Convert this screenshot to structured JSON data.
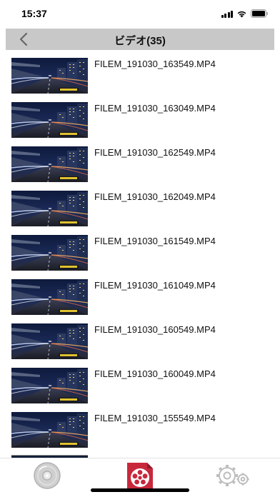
{
  "status_bar": {
    "time": "15:37",
    "icons": [
      "cellular-signal-icon",
      "wifi-icon",
      "battery-icon"
    ]
  },
  "header": {
    "title": "ビデオ(35)",
    "back_icon": "chevron-left-icon"
  },
  "videos": [
    {
      "file_name": "FILEM_191030_163549.MP4"
    },
    {
      "file_name": "FILEM_191030_163049.MP4"
    },
    {
      "file_name": "FILEM_191030_162549.MP4"
    },
    {
      "file_name": "FILEM_191030_162049.MP4"
    },
    {
      "file_name": "FILEM_191030_161549.MP4"
    },
    {
      "file_name": "FILEM_191030_161049.MP4"
    },
    {
      "file_name": "FILEM_191030_160549.MP4"
    },
    {
      "file_name": "FILEM_191030_160049.MP4"
    },
    {
      "file_name": "FILEM_191030_155549.MP4"
    }
  ],
  "tab_bar": {
    "tabs": [
      {
        "icon": "disc-icon",
        "selected": false
      },
      {
        "icon": "film-reel-icon",
        "selected": true
      },
      {
        "icon": "settings-gear-icon",
        "selected": false
      }
    ]
  },
  "colors": {
    "nav_background": "#c8c8c8",
    "accent_red": "#c8283c",
    "inactive_icon": "#bdbdbd"
  }
}
